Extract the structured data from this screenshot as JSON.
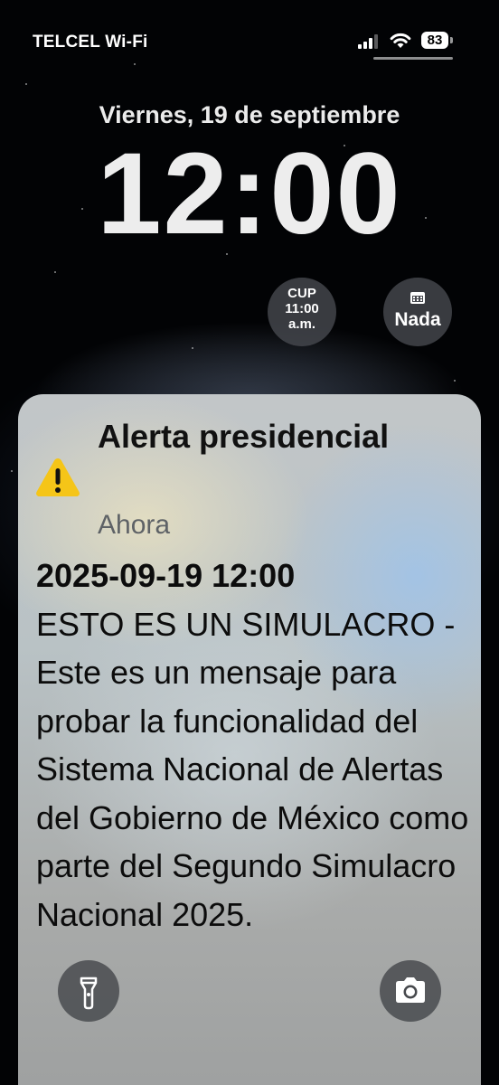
{
  "status_bar": {
    "carrier": "TELCEL Wi-Fi",
    "battery": "83"
  },
  "lock_screen": {
    "date": "Viernes, 19 de septiembre",
    "time": "12:00",
    "widgets": {
      "cup": {
        "line1": "CUP",
        "line2": "11:00",
        "line3": "a.m."
      },
      "calendar": {
        "icon": "calendar-icon",
        "label": "Nada"
      }
    }
  },
  "notification": {
    "icon": "warning-icon",
    "title": "Alerta presidencial",
    "time": "Ahora",
    "timestamp": "2025-09-19 12:00",
    "message": "ESTO ES UN SIMULACRO - Este es un mensaje para probar la funcionalidad del Sistema Nacional de Alertas del Gobierno de México como parte del Segundo Simulacro Nacional 2025."
  },
  "quick_actions": {
    "left_icon": "flashlight-icon",
    "right_icon": "camera-icon"
  },
  "colors": {
    "warning": "#f5c518",
    "widget_bg": "#46484e",
    "text_primary": "#111111",
    "text_secondary": "#5e6266"
  }
}
